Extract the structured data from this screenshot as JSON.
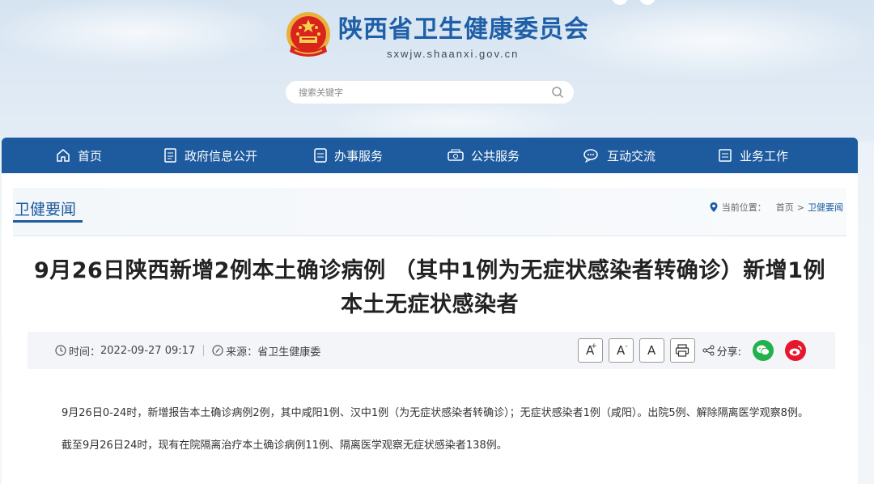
{
  "header": {
    "site_title": "陕西省卫生健康委员会",
    "site_domain": "sxwjw.shaanxi.gov.cn",
    "search_placeholder": "搜索关键字"
  },
  "nav": [
    {
      "label": "首页",
      "icon": "home-icon"
    },
    {
      "label": "政府信息公开",
      "icon": "document-icon"
    },
    {
      "label": "办事服务",
      "icon": "service-icon"
    },
    {
      "label": "公共服务",
      "icon": "public-service-icon"
    },
    {
      "label": "互动交流",
      "icon": "chat-icon"
    },
    {
      "label": "业务工作",
      "icon": "work-icon"
    }
  ],
  "section": {
    "title": "卫健要闻",
    "breadcrumb_prefix": "当前位置：",
    "breadcrumb_home": "首页",
    "breadcrumb_sep": ">",
    "breadcrumb_current": "卫健要闻"
  },
  "article": {
    "title": "9月26日陕西新增2例本土确诊病例 （其中1例为无症状感染者转确诊）新增1例本土无症状感染者",
    "time_label": "时间：",
    "time": "2022-09-27 09:17",
    "source_label": "来源：",
    "source": "省卫生健康委",
    "font_large": "A",
    "font_small": "A",
    "font_normal": "A",
    "share_label": "分享:",
    "paragraphs": [
      "9月26日0-24时，新增报告本土确诊病例2例，其中咸阳1例、汉中1例（为无症状感染者转确诊）；无症状感染者1例（咸阳）。出院5例、解除隔离医学观察8例。",
      "截至9月26日24时，现有在院隔离治疗本土确诊病例11例、隔离医学观察无症状感染者138例。"
    ]
  },
  "colors": {
    "brand_blue": "#1d5b9e",
    "wechat_green": "#22b14c",
    "weibo_red": "#e6162d"
  }
}
